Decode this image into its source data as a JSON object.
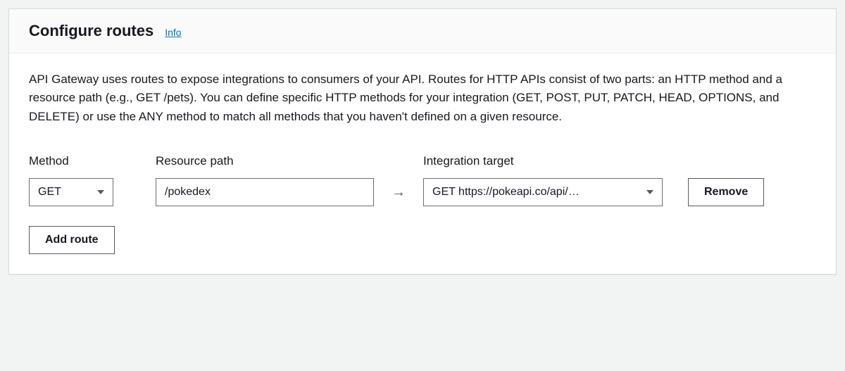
{
  "panel": {
    "title": "Configure routes",
    "info_link": "Info",
    "description": "API Gateway uses routes to expose integrations to consumers of your API. Routes for HTTP APIs consist of two parts: an HTTP method and a resource path (e.g., GET /pets). You can define specific HTTP methods for your integration (GET, POST, PUT, PATCH, HEAD, OPTIONS, and DELETE) or use the ANY method to match all methods that you haven't defined on a given resource."
  },
  "labels": {
    "method": "Method",
    "resource_path": "Resource path",
    "integration_target": "Integration target"
  },
  "route": {
    "method": "GET",
    "resource_path": "/pokedex",
    "integration_target": "GET https://pokeapi.co/api/…"
  },
  "buttons": {
    "remove": "Remove",
    "add_route": "Add route"
  },
  "arrow": "→"
}
